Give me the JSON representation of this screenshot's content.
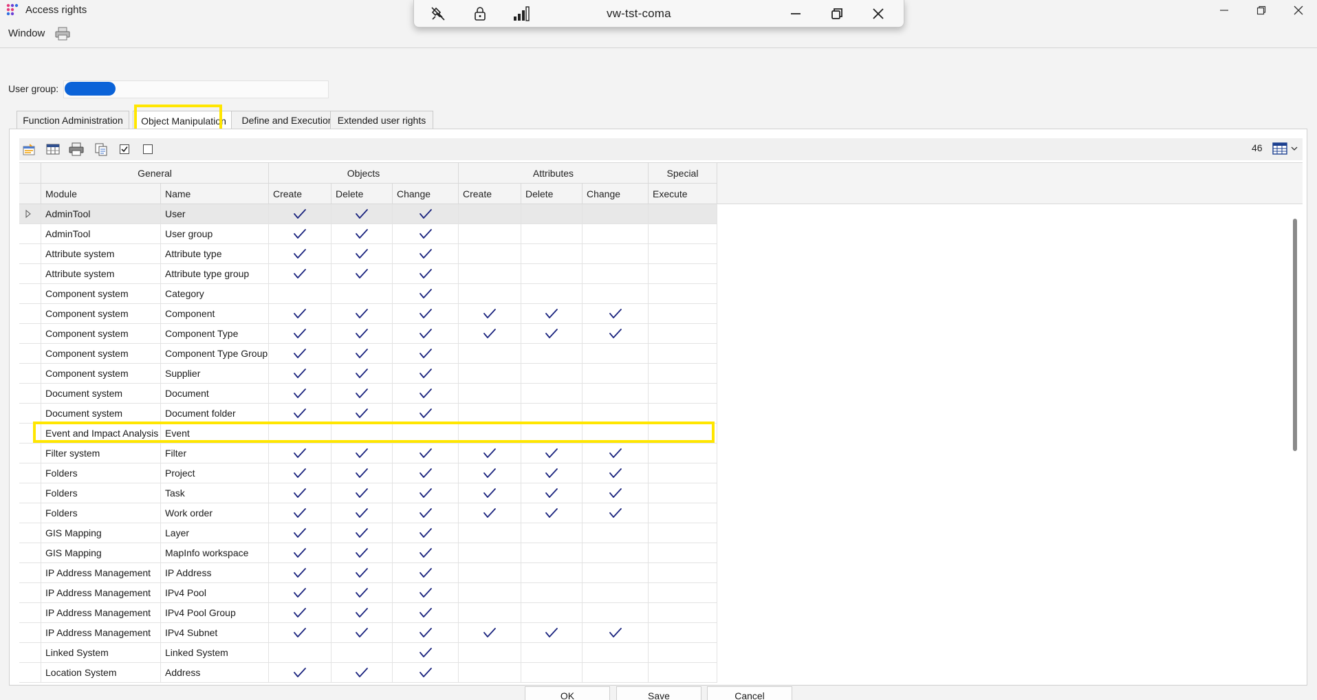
{
  "window": {
    "title": "Access rights",
    "controls": [
      "minimize",
      "restore",
      "close"
    ]
  },
  "remote_bar": {
    "host": "vw-tst-coma",
    "icons": [
      "unpin-icon",
      "lock-icon",
      "signal-icon"
    ]
  },
  "menu": {
    "window_label": "Window"
  },
  "user_group": {
    "label": "User group:"
  },
  "tabs": [
    {
      "label": "Function Administration"
    },
    {
      "label": "Object Manipulation",
      "active": true
    },
    {
      "label": "Define and Execution"
    },
    {
      "label": "Extended user rights"
    }
  ],
  "toolbar": {
    "count": "46",
    "buttons": [
      "export-icon",
      "columns-icon",
      "print-icon",
      "copy-icon",
      "check-all-icon",
      "uncheck-all-icon"
    ]
  },
  "grid": {
    "groups": [
      {
        "label": "General"
      },
      {
        "label": "Objects"
      },
      {
        "label": "Attributes"
      },
      {
        "label": "Special"
      }
    ],
    "columns": [
      "Module",
      "Name",
      "Create",
      "Delete",
      "Change",
      "Create",
      "Delete",
      "Change",
      "Execute"
    ],
    "rows": [
      {
        "module": "AdminTool",
        "name": "User",
        "checks": [
          1,
          1,
          1,
          0,
          0,
          0,
          0
        ]
      },
      {
        "module": "AdminTool",
        "name": "User group",
        "checks": [
          1,
          1,
          1,
          0,
          0,
          0,
          0
        ]
      },
      {
        "module": "Attribute system",
        "name": "Attribute type",
        "checks": [
          1,
          1,
          1,
          0,
          0,
          0,
          0
        ]
      },
      {
        "module": "Attribute system",
        "name": "Attribute type group",
        "checks": [
          1,
          1,
          1,
          0,
          0,
          0,
          0
        ]
      },
      {
        "module": "Component system",
        "name": "Category",
        "checks": [
          0,
          0,
          1,
          0,
          0,
          0,
          0
        ]
      },
      {
        "module": "Component system",
        "name": "Component",
        "checks": [
          1,
          1,
          1,
          1,
          1,
          1,
          0
        ]
      },
      {
        "module": "Component system",
        "name": "Component Type",
        "checks": [
          1,
          1,
          1,
          1,
          1,
          1,
          0
        ]
      },
      {
        "module": "Component system",
        "name": "Component Type Group",
        "checks": [
          1,
          1,
          1,
          0,
          0,
          0,
          0
        ]
      },
      {
        "module": "Component system",
        "name": "Supplier",
        "checks": [
          1,
          1,
          1,
          0,
          0,
          0,
          0
        ]
      },
      {
        "module": "Document system",
        "name": "Document",
        "checks": [
          1,
          1,
          1,
          0,
          0,
          0,
          0
        ]
      },
      {
        "module": "Document system",
        "name": "Document folder",
        "checks": [
          1,
          1,
          1,
          0,
          0,
          0,
          0
        ]
      },
      {
        "module": "Event and Impact Analysis",
        "name": "Event",
        "checks": [
          0,
          0,
          0,
          0,
          0,
          0,
          0
        ]
      },
      {
        "module": "Filter system",
        "name": "Filter",
        "checks": [
          1,
          1,
          1,
          1,
          1,
          1,
          0
        ]
      },
      {
        "module": "Folders",
        "name": "Project",
        "checks": [
          1,
          1,
          1,
          1,
          1,
          1,
          0
        ]
      },
      {
        "module": "Folders",
        "name": "Task",
        "checks": [
          1,
          1,
          1,
          1,
          1,
          1,
          0
        ]
      },
      {
        "module": "Folders",
        "name": "Work order",
        "checks": [
          1,
          1,
          1,
          1,
          1,
          1,
          0
        ]
      },
      {
        "module": "GIS Mapping",
        "name": "Layer",
        "checks": [
          1,
          1,
          1,
          0,
          0,
          0,
          0
        ]
      },
      {
        "module": "GIS Mapping",
        "name": "MapInfo workspace",
        "checks": [
          1,
          1,
          1,
          0,
          0,
          0,
          0
        ]
      },
      {
        "module": "IP Address Management",
        "name": "IP Address",
        "checks": [
          1,
          1,
          1,
          0,
          0,
          0,
          0
        ]
      },
      {
        "module": "IP Address Management",
        "name": "IPv4 Pool",
        "checks": [
          1,
          1,
          1,
          0,
          0,
          0,
          0
        ]
      },
      {
        "module": "IP Address Management",
        "name": "IPv4 Pool Group",
        "checks": [
          1,
          1,
          1,
          0,
          0,
          0,
          0
        ]
      },
      {
        "module": "IP Address Management",
        "name": "IPv4 Subnet",
        "checks": [
          1,
          1,
          1,
          1,
          1,
          1,
          0
        ]
      },
      {
        "module": "Linked System",
        "name": "Linked System",
        "checks": [
          0,
          0,
          1,
          0,
          0,
          0,
          0
        ]
      },
      {
        "module": "Location System",
        "name": "Address",
        "checks": [
          1,
          1,
          1,
          0,
          0,
          0,
          0
        ]
      }
    ]
  },
  "buttons": {
    "ok": "OK",
    "save": "Save",
    "cancel": "Cancel"
  },
  "colors": {
    "highlight": "#ffe600",
    "check": "#1a237e",
    "redaction": "#0b63d8"
  }
}
